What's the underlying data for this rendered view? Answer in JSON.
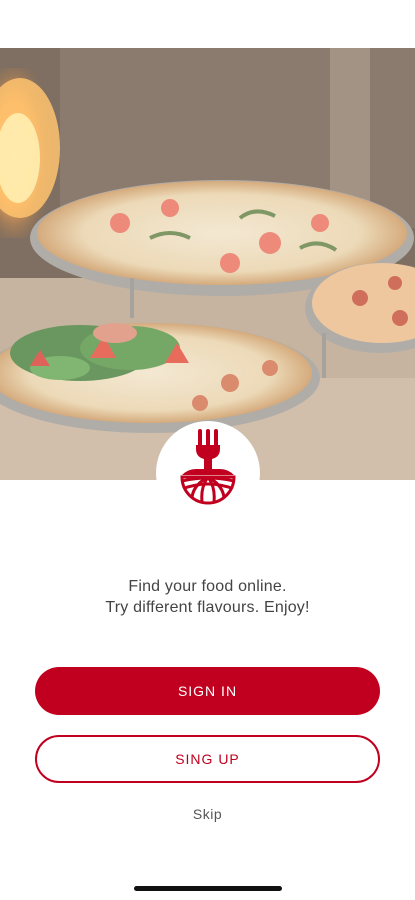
{
  "app": {
    "brand_color": "#c0001e",
    "logo_icon": "fork-field-logo-icon"
  },
  "hero": {
    "image_subject": "pizzas-on-table-photo"
  },
  "tagline": {
    "line1": "Find your food online.",
    "line2": "Try different flavours. Enjoy!"
  },
  "actions": {
    "sign_in_label": "SIGN IN",
    "sign_up_label": "SING UP",
    "skip_label": "Skip"
  }
}
